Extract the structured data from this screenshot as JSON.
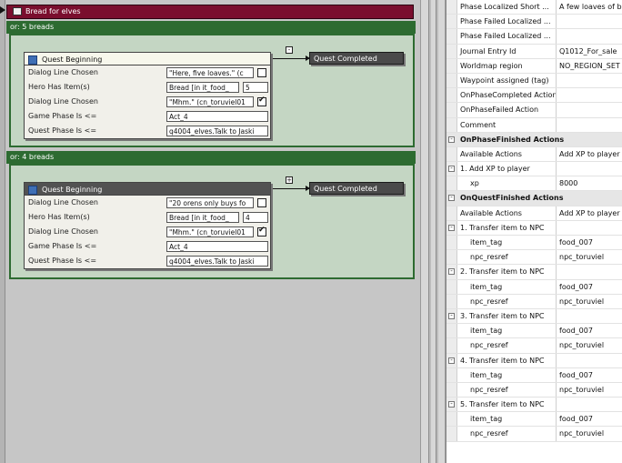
{
  "canvas": {
    "title": "Bread for elves",
    "branches": [
      {
        "header": "or: 5 breads",
        "toggle": "-",
        "node": {
          "title": "Quest Beginning",
          "rows": [
            {
              "label": "Dialog Line Chosen",
              "value": "\"Here, five loaves.\" (c",
              "checked": false
            },
            {
              "label": "Hero Has Item(s)",
              "value": "Bread [in it_food_",
              "number": "5"
            },
            {
              "label": "Dialog Line Chosen",
              "value": "\"Mhm.\" (cn_toruviel01",
              "checked": true
            },
            {
              "label": "Game Phase Is <=",
              "value": "Act_4"
            },
            {
              "label": "Quest Phase Is <=",
              "value": "q4004_elves.Talk to Jaski"
            }
          ]
        },
        "outcome": "Quest Completed"
      },
      {
        "header": "or: 4 breads",
        "toggle": "+",
        "node": {
          "title": "Quest Beginning",
          "rows": [
            {
              "label": "Dialog Line Chosen",
              "value": "\"20 orens only buys fo",
              "checked": false
            },
            {
              "label": "Hero Has Item(s)",
              "value": "Bread [in it_food_",
              "number": "4"
            },
            {
              "label": "Dialog Line Chosen",
              "value": "\"Mhm.\" (cn_toruviel01",
              "checked": true
            },
            {
              "label": "Game Phase Is <=",
              "value": "Act_4"
            },
            {
              "label": "Quest Phase Is <=",
              "value": "q4004_elves.Talk to Jaski"
            }
          ]
        },
        "outcome": "Quest Completed"
      }
    ]
  },
  "properties": [
    {
      "type": "prop",
      "name": "Phase Localized Short ...",
      "value": "A few loaves of br"
    },
    {
      "type": "prop",
      "name": "Phase Failed Localized ...",
      "value": ""
    },
    {
      "type": "prop",
      "name": "Phase Failed Localized ...",
      "value": ""
    },
    {
      "type": "prop",
      "name": "Journal Entry Id",
      "value": "Q1012_For_sale"
    },
    {
      "type": "prop",
      "name": "Worldmap region",
      "value": "NO_REGION_SET"
    },
    {
      "type": "prop",
      "name": "Waypoint assigned (tag)",
      "value": ""
    },
    {
      "type": "prop",
      "name": "OnPhaseCompleted Action",
      "value": ""
    },
    {
      "type": "prop",
      "name": "OnPhaseFailed Action",
      "value": ""
    },
    {
      "type": "prop",
      "name": "Comment",
      "value": ""
    },
    {
      "type": "cat",
      "name": "OnPhaseFinished Actions",
      "toggle": "-"
    },
    {
      "type": "prop",
      "name": "Available Actions",
      "value": "Add XP to player"
    },
    {
      "type": "group",
      "name": "1. Add XP to player",
      "value": "",
      "toggle": "-"
    },
    {
      "type": "sub",
      "name": "xp",
      "value": "8000"
    },
    {
      "type": "cat",
      "name": "OnQuestFinished Actions",
      "toggle": "-"
    },
    {
      "type": "prop",
      "name": "Available Actions",
      "value": "Add XP to player"
    },
    {
      "type": "group",
      "name": "1. Transfer item to NPC",
      "value": "",
      "toggle": "-"
    },
    {
      "type": "sub",
      "name": "item_tag",
      "value": "food_007"
    },
    {
      "type": "sub",
      "name": "npc_resref",
      "value": "npc_toruviel"
    },
    {
      "type": "group",
      "name": "2. Transfer item to NPC",
      "value": "",
      "toggle": "-"
    },
    {
      "type": "sub",
      "name": "item_tag",
      "value": "food_007"
    },
    {
      "type": "sub",
      "name": "npc_resref",
      "value": "npc_toruviel"
    },
    {
      "type": "group",
      "name": "3. Transfer item to NPC",
      "value": "",
      "toggle": "-"
    },
    {
      "type": "sub",
      "name": "item_tag",
      "value": "food_007"
    },
    {
      "type": "sub",
      "name": "npc_resref",
      "value": "npc_toruviel"
    },
    {
      "type": "group",
      "name": "4. Transfer item to NPC",
      "value": "",
      "toggle": "-"
    },
    {
      "type": "sub",
      "name": "item_tag",
      "value": "food_007"
    },
    {
      "type": "sub",
      "name": "npc_resref",
      "value": "npc_toruviel"
    },
    {
      "type": "group",
      "name": "5. Transfer item to NPC",
      "value": "",
      "toggle": "-"
    },
    {
      "type": "sub",
      "name": "item_tag",
      "value": "food_007"
    },
    {
      "type": "sub",
      "name": "npc_resref",
      "value": "npc_toruviel"
    }
  ]
}
